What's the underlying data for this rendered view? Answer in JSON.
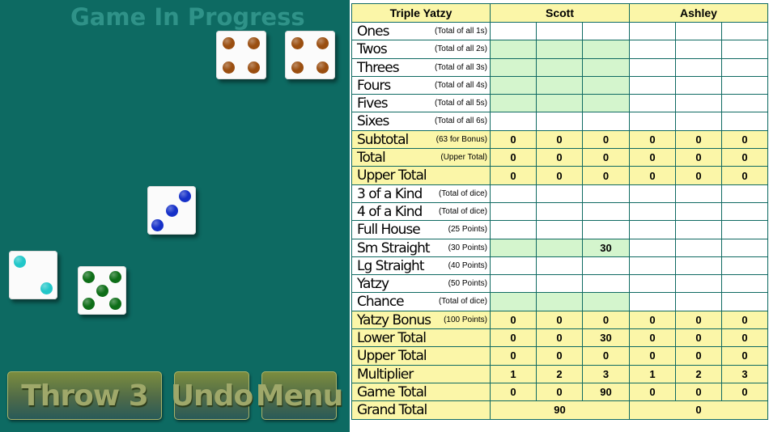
{
  "status_text": "Game In Progress",
  "dice": [
    {
      "id": "die-1",
      "value": 4,
      "color": "#9a4e10"
    },
    {
      "id": "die-2",
      "value": 4,
      "color": "#9a4e10"
    },
    {
      "id": "die-3",
      "value": 3,
      "color": "#1530c8"
    },
    {
      "id": "die-4",
      "value": 2,
      "color": "#22c7c9"
    },
    {
      "id": "die-5",
      "value": 5,
      "color": "#0e6e18"
    }
  ],
  "buttons": {
    "throw": "Throw 3",
    "undo": "Undo",
    "menu": "Menu"
  },
  "header": {
    "title": "Triple Yatzy",
    "player1": "Scott",
    "player2": "Ashley"
  },
  "rows": [
    {
      "label": "Ones",
      "hint": "(Total of all 1s)",
      "type": "w",
      "s": [
        "",
        "",
        ""
      ],
      "a": [
        "",
        "",
        ""
      ]
    },
    {
      "label": "Twos",
      "hint": "(Total of all 2s)",
      "type": "g",
      "s": [
        "",
        "",
        ""
      ],
      "a": [
        "",
        "",
        ""
      ]
    },
    {
      "label": "Threes",
      "hint": "(Total of all 3s)",
      "type": "g",
      "s": [
        "",
        "",
        ""
      ],
      "a": [
        "",
        "",
        ""
      ]
    },
    {
      "label": "Fours",
      "hint": "(Total of all 4s)",
      "type": "g",
      "s": [
        "",
        "",
        ""
      ],
      "a": [
        "",
        "",
        ""
      ]
    },
    {
      "label": "Fives",
      "hint": "(Total of all 5s)",
      "type": "g",
      "s": [
        "",
        "",
        ""
      ],
      "a": [
        "",
        "",
        ""
      ]
    },
    {
      "label": "Sixes",
      "hint": "(Total of all 6s)",
      "type": "w",
      "s": [
        "",
        "",
        ""
      ],
      "a": [
        "",
        "",
        ""
      ]
    },
    {
      "label": "Subtotal",
      "hint": "(63 for Bonus)",
      "type": "y",
      "s": [
        "0",
        "0",
        "0"
      ],
      "a": [
        "0",
        "0",
        "0"
      ]
    },
    {
      "label": "Total",
      "hint": "(Upper Total)",
      "type": "y",
      "s": [
        "0",
        "0",
        "0"
      ],
      "a": [
        "0",
        "0",
        "0"
      ]
    },
    {
      "label": "Upper Total",
      "hint": "",
      "type": "y",
      "s": [
        "0",
        "0",
        "0"
      ],
      "a": [
        "0",
        "0",
        "0"
      ]
    },
    {
      "label": "3 of a Kind",
      "hint": "(Total of dice)",
      "type": "w",
      "s": [
        "",
        "",
        ""
      ],
      "a": [
        "",
        "",
        ""
      ]
    },
    {
      "label": "4 of a Kind",
      "hint": "(Total of dice)",
      "type": "w",
      "s": [
        "",
        "",
        ""
      ],
      "a": [
        "",
        "",
        ""
      ]
    },
    {
      "label": "Full House",
      "hint": "(25 Points)",
      "type": "w",
      "s": [
        "",
        "",
        ""
      ],
      "a": [
        "",
        "",
        ""
      ]
    },
    {
      "label": "Sm Straight",
      "hint": "(30 Points)",
      "type": "g",
      "s": [
        "",
        "",
        "30"
      ],
      "a": [
        "",
        "",
        ""
      ]
    },
    {
      "label": "Lg Straight",
      "hint": "(40 Points)",
      "type": "w",
      "s": [
        "",
        "",
        ""
      ],
      "a": [
        "",
        "",
        ""
      ]
    },
    {
      "label": "Yatzy",
      "hint": "(50 Points)",
      "type": "w",
      "s": [
        "",
        "",
        ""
      ],
      "a": [
        "",
        "",
        ""
      ]
    },
    {
      "label": "Chance",
      "hint": "(Total of dice)",
      "type": "g",
      "s": [
        "",
        "",
        ""
      ],
      "a": [
        "",
        "",
        ""
      ]
    },
    {
      "label": "Yatzy Bonus",
      "hint": "(100 Points)",
      "type": "y",
      "s": [
        "0",
        "0",
        "0"
      ],
      "a": [
        "0",
        "0",
        "0"
      ]
    },
    {
      "label": "Lower Total",
      "hint": "",
      "type": "y",
      "s": [
        "0",
        "0",
        "30"
      ],
      "a": [
        "0",
        "0",
        "0"
      ]
    },
    {
      "label": "Upper Total",
      "hint": "",
      "type": "y",
      "s": [
        "0",
        "0",
        "0"
      ],
      "a": [
        "0",
        "0",
        "0"
      ]
    },
    {
      "label": "Multiplier",
      "hint": "",
      "type": "y",
      "s": [
        "1",
        "2",
        "3"
      ],
      "a": [
        "1",
        "2",
        "3"
      ]
    },
    {
      "label": "Game Total",
      "hint": "",
      "type": "y",
      "s": [
        "0",
        "0",
        "90"
      ],
      "a": [
        "0",
        "0",
        "0"
      ]
    }
  ],
  "grand_total": {
    "label": "Grand Total",
    "scott": "90",
    "ashley": "0"
  }
}
